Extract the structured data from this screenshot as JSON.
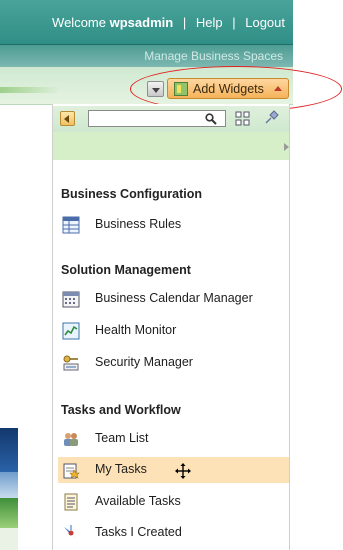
{
  "header": {
    "welcome_prefix": "Welcome",
    "username": "wpsadmin",
    "separator": "|",
    "help_link": "Help",
    "logout_link": "Logout",
    "manage_link": "Manage Business Spaces",
    "add_widgets_label": "Add Widgets"
  },
  "flyout": {
    "search": {
      "value": "",
      "placeholder": ""
    },
    "sections": [
      {
        "title": "Business Configuration",
        "items": [
          {
            "label": "Business Rules",
            "icon": "table-icon"
          }
        ]
      },
      {
        "title": "Solution Management",
        "items": [
          {
            "label": "Business Calendar Manager",
            "icon": "calendar-icon"
          },
          {
            "label": "Health Monitor",
            "icon": "health-chart-icon"
          },
          {
            "label": "Security Manager",
            "icon": "keys-icon"
          }
        ]
      },
      {
        "title": "Tasks and Workflow",
        "items": [
          {
            "label": "Team List",
            "icon": "team-icon"
          },
          {
            "label": "My Tasks",
            "icon": "my-tasks-icon",
            "selected": true
          },
          {
            "label": "Available Tasks",
            "icon": "task-list-icon"
          },
          {
            "label": "Tasks I Created",
            "icon": "created-task-icon"
          }
        ]
      }
    ]
  },
  "colors": {
    "header_teal": "#2f8f86",
    "add_widgets_orange": "#f5b35a",
    "highlight_ellipse": "#e02020",
    "selected_row": "#fde2b8",
    "flyout_green": "#d7efc9"
  }
}
